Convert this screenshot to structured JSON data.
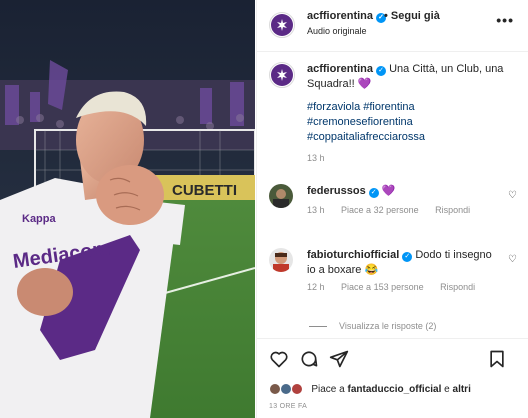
{
  "media": {
    "jersey_sponsor_text": "Mediacom",
    "board_text": "CUBETTI",
    "brand_text": "Kappa"
  },
  "post": {
    "username": "acffiorentina",
    "follow_status": "• Segui già",
    "audio": "Audio originale",
    "more_icon": "more-horizontal-icon"
  },
  "caption": {
    "username": "acffiorentina",
    "text": "Una Città, un Club, una Squadra!! 💜",
    "hashtags": [
      "#forzaviola #fiorentina",
      "#cremonesefiorentina",
      "#coppaitaliafrecciarossa"
    ],
    "time": "13 h"
  },
  "comments": [
    {
      "username": "federussos",
      "text": "💜",
      "time": "13 h",
      "likes": "Piace a 32 persone",
      "reply": "Rispondi"
    },
    {
      "username": "fabioturchiofficial",
      "text": "Dodo ti insegno io a boxare 😂",
      "time": "12 h",
      "likes": "Piace a 153 persone",
      "reply": "Rispondi"
    }
  ],
  "replies_label": "Visualizza le risposte (2)",
  "likes": {
    "prefix": "Piace a ",
    "user": "fantaduccio_official",
    "middle": " e ",
    "suffix": "altri"
  },
  "timestamp": "13 ORE FA",
  "colors": {
    "brand_purple": "#5b2a86",
    "verified": "#0095f6",
    "hashtag": "#00376b"
  }
}
